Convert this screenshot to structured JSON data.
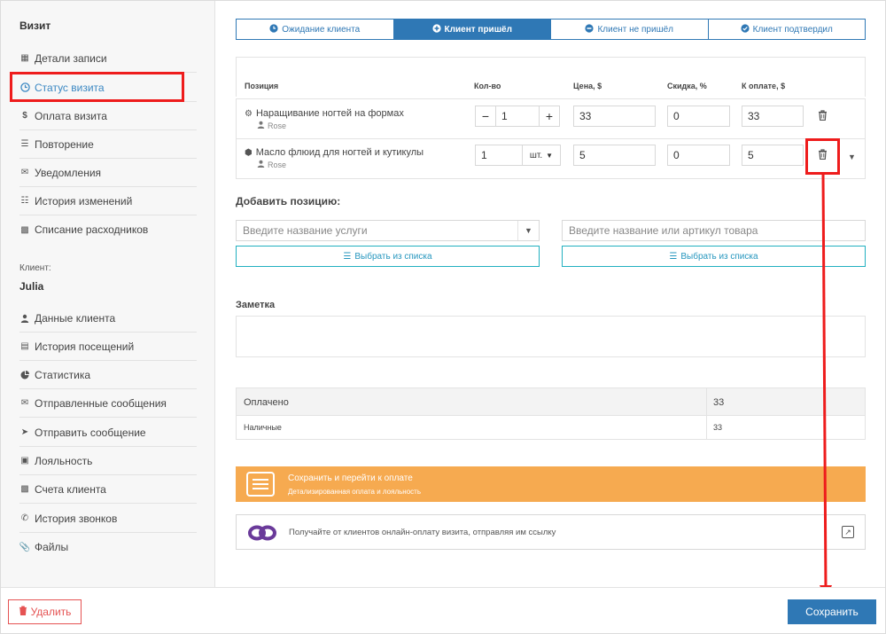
{
  "sidebar": {
    "visit_title": "Визит",
    "visit_items": [
      {
        "label": "Детали записи",
        "icon": "calendar-icon"
      },
      {
        "label": "Статус визита",
        "icon": "clock-icon"
      },
      {
        "label": "Оплата визита",
        "icon": "dollar-icon"
      },
      {
        "label": "Повторение",
        "icon": "list-icon"
      },
      {
        "label": "Уведомления",
        "icon": "chat-icon"
      },
      {
        "label": "История изменений",
        "icon": "document-icon"
      },
      {
        "label": "Списание расходников",
        "icon": "cubes-icon"
      }
    ],
    "client_caption": "Клиент:",
    "client_name": "Julia",
    "client_items": [
      {
        "label": "Данные клиента",
        "icon": "user-icon"
      },
      {
        "label": "История посещений",
        "icon": "history-icon"
      },
      {
        "label": "Статистика",
        "icon": "pie-chart-icon"
      },
      {
        "label": "Отправленные сообщения",
        "icon": "envelope-icon"
      },
      {
        "label": "Отправить сообщение",
        "icon": "send-icon"
      },
      {
        "label": "Лояльность",
        "icon": "card-icon"
      },
      {
        "label": "Счета клиента",
        "icon": "wallet-icon"
      },
      {
        "label": "История звонков",
        "icon": "phone-icon"
      },
      {
        "label": "Файлы",
        "icon": "paperclip-icon"
      }
    ]
  },
  "tabs": [
    {
      "label": "Ожидание клиента",
      "icon": "clock-icon"
    },
    {
      "label": "Клиент пришёл",
      "icon": "plus-circle-icon"
    },
    {
      "label": "Клиент не пришёл",
      "icon": "minus-circle-icon"
    },
    {
      "label": "Клиент подтвердил",
      "icon": "check-circle-icon"
    }
  ],
  "table": {
    "headers": {
      "position": "Позиция",
      "qty": "Кол-во",
      "price": "Цена, $",
      "discount": "Скидка, %",
      "to_pay": "К оплате, $"
    },
    "rows": [
      {
        "name": "Наращивание ногтей на формах",
        "staff": "Rose",
        "qty": "1",
        "price": "33",
        "discount": "0",
        "to_pay": "33",
        "minus": "−",
        "plus": "+"
      },
      {
        "name": "Масло флюид для ногтей и кутикулы",
        "staff": "Rose",
        "qty": "1",
        "unit": "шт.",
        "price": "5",
        "discount": "0",
        "to_pay": "5"
      }
    ]
  },
  "add_position": {
    "title": "Добавить позицию:",
    "service_placeholder": "Введите название услуги",
    "product_placeholder": "Введите название или артикул товара",
    "choose_from_list": "Выбрать из списка"
  },
  "note": {
    "title": "Заметка",
    "value": ""
  },
  "payment": {
    "paid_label": "Оплачено",
    "paid_value": "33",
    "cash_label": "Наличные",
    "cash_value": "33"
  },
  "save_and_pay": {
    "title": "Сохранить и перейти к оплате",
    "subtitle": "Детализированная оплата и лояльность"
  },
  "online_pay": {
    "text": "Получайте от клиентов онлайн-оплату визита, отправляя им ссылку"
  },
  "footer": {
    "delete_label": "Удалить",
    "save_label": "Сохранить"
  },
  "colors": {
    "primary": "#2f78b5",
    "accent_orange": "#f6aa50",
    "teal": "#22b0c0",
    "highlight_red": "#ee1c1c",
    "danger": "#e55353"
  }
}
